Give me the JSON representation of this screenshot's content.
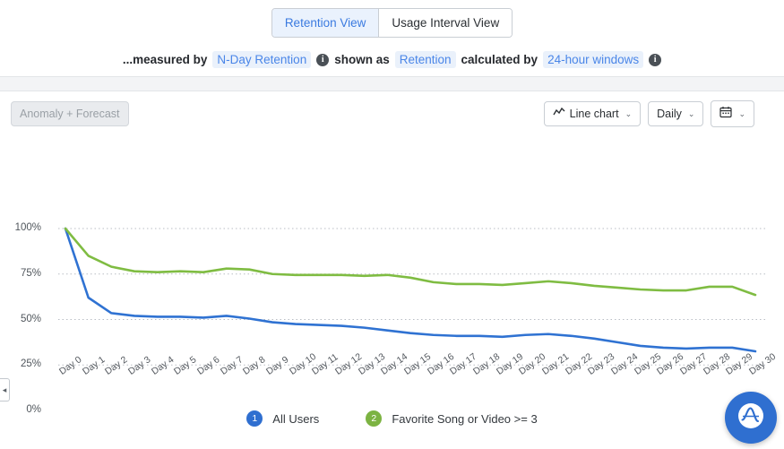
{
  "tabs": {
    "items": [
      {
        "label": "Retention View",
        "active": true
      },
      {
        "label": "Usage Interval View",
        "active": false
      }
    ]
  },
  "measure_bar": {
    "prefix": "...measured by",
    "metric": "N-Day Retention",
    "info_1": "i",
    "shown_as_label": "shown as",
    "shown_as_value": "Retention",
    "calculated_by_label": "calculated by",
    "calculated_by_value": "24-hour windows",
    "info_2": "i"
  },
  "toolbar": {
    "anomaly_label": "Anomaly + Forecast",
    "chart_type_label": "Line chart",
    "interval_label": "Daily",
    "caret": "⌄"
  },
  "legend": {
    "items": [
      {
        "badge": "1",
        "label": "All Users",
        "color": "#2f6fd0"
      },
      {
        "badge": "2",
        "label": "Favorite Song or Video >= 3",
        "color": "#7cb342"
      }
    ]
  },
  "collapse_handle": {
    "glyph": "◂"
  },
  "fab": {
    "label": "A"
  },
  "colors": {
    "series_1": "#2f72d2",
    "series_2": "#7fbc42",
    "chip_text": "#4a86e8",
    "chip_bg": "#eaf1fb",
    "grid": "#b9bdc4"
  },
  "chart_data": {
    "type": "line",
    "title": "",
    "xlabel": "",
    "ylabel": "",
    "ylim": [
      0,
      100
    ],
    "ytick_labels": [
      "100%",
      "75%",
      "50%",
      "25%",
      "0%"
    ],
    "ytick_values": [
      100,
      75,
      50,
      25,
      0
    ],
    "grid": true,
    "legend_position": "bottom",
    "categories": [
      "Day 0",
      "Day 1",
      "Day 2",
      "Day 3",
      "Day 4",
      "Day 5",
      "Day 6",
      "Day 7",
      "Day 8",
      "Day 9",
      "Day 10",
      "Day 11",
      "Day 12",
      "Day 13",
      "Day 14",
      "Day 15",
      "Day 16",
      "Day 17",
      "Day 18",
      "Day 19",
      "Day 20",
      "Day 21",
      "Day 22",
      "Day 23",
      "Day 24",
      "Day 25",
      "Day 26",
      "Day 27",
      "Day 28",
      "Day 29",
      "Day 30"
    ],
    "series": [
      {
        "name": "All Users",
        "color": "#2f72d2",
        "values": [
          100,
          62,
          53.5,
          52,
          51.5,
          51.5,
          51,
          52,
          50.5,
          48.5,
          47.5,
          47,
          46.5,
          45.5,
          44,
          42.5,
          41.5,
          41,
          41,
          40.5,
          41.5,
          42,
          41,
          39.5,
          37.5,
          35.5,
          34.5,
          34,
          34.5,
          34.5,
          32.5
        ]
      },
      {
        "name": "Favorite Song or Video >= 3",
        "color": "#7fbc42",
        "values": [
          100,
          85,
          79,
          76.5,
          76,
          76.5,
          76,
          78,
          77.5,
          75,
          74.5,
          74.5,
          74.5,
          74,
          74.5,
          73,
          70.5,
          69.5,
          69.5,
          69,
          70,
          71,
          70,
          68.5,
          67.5,
          66.5,
          66,
          66,
          68,
          68,
          63.5
        ]
      }
    ]
  }
}
